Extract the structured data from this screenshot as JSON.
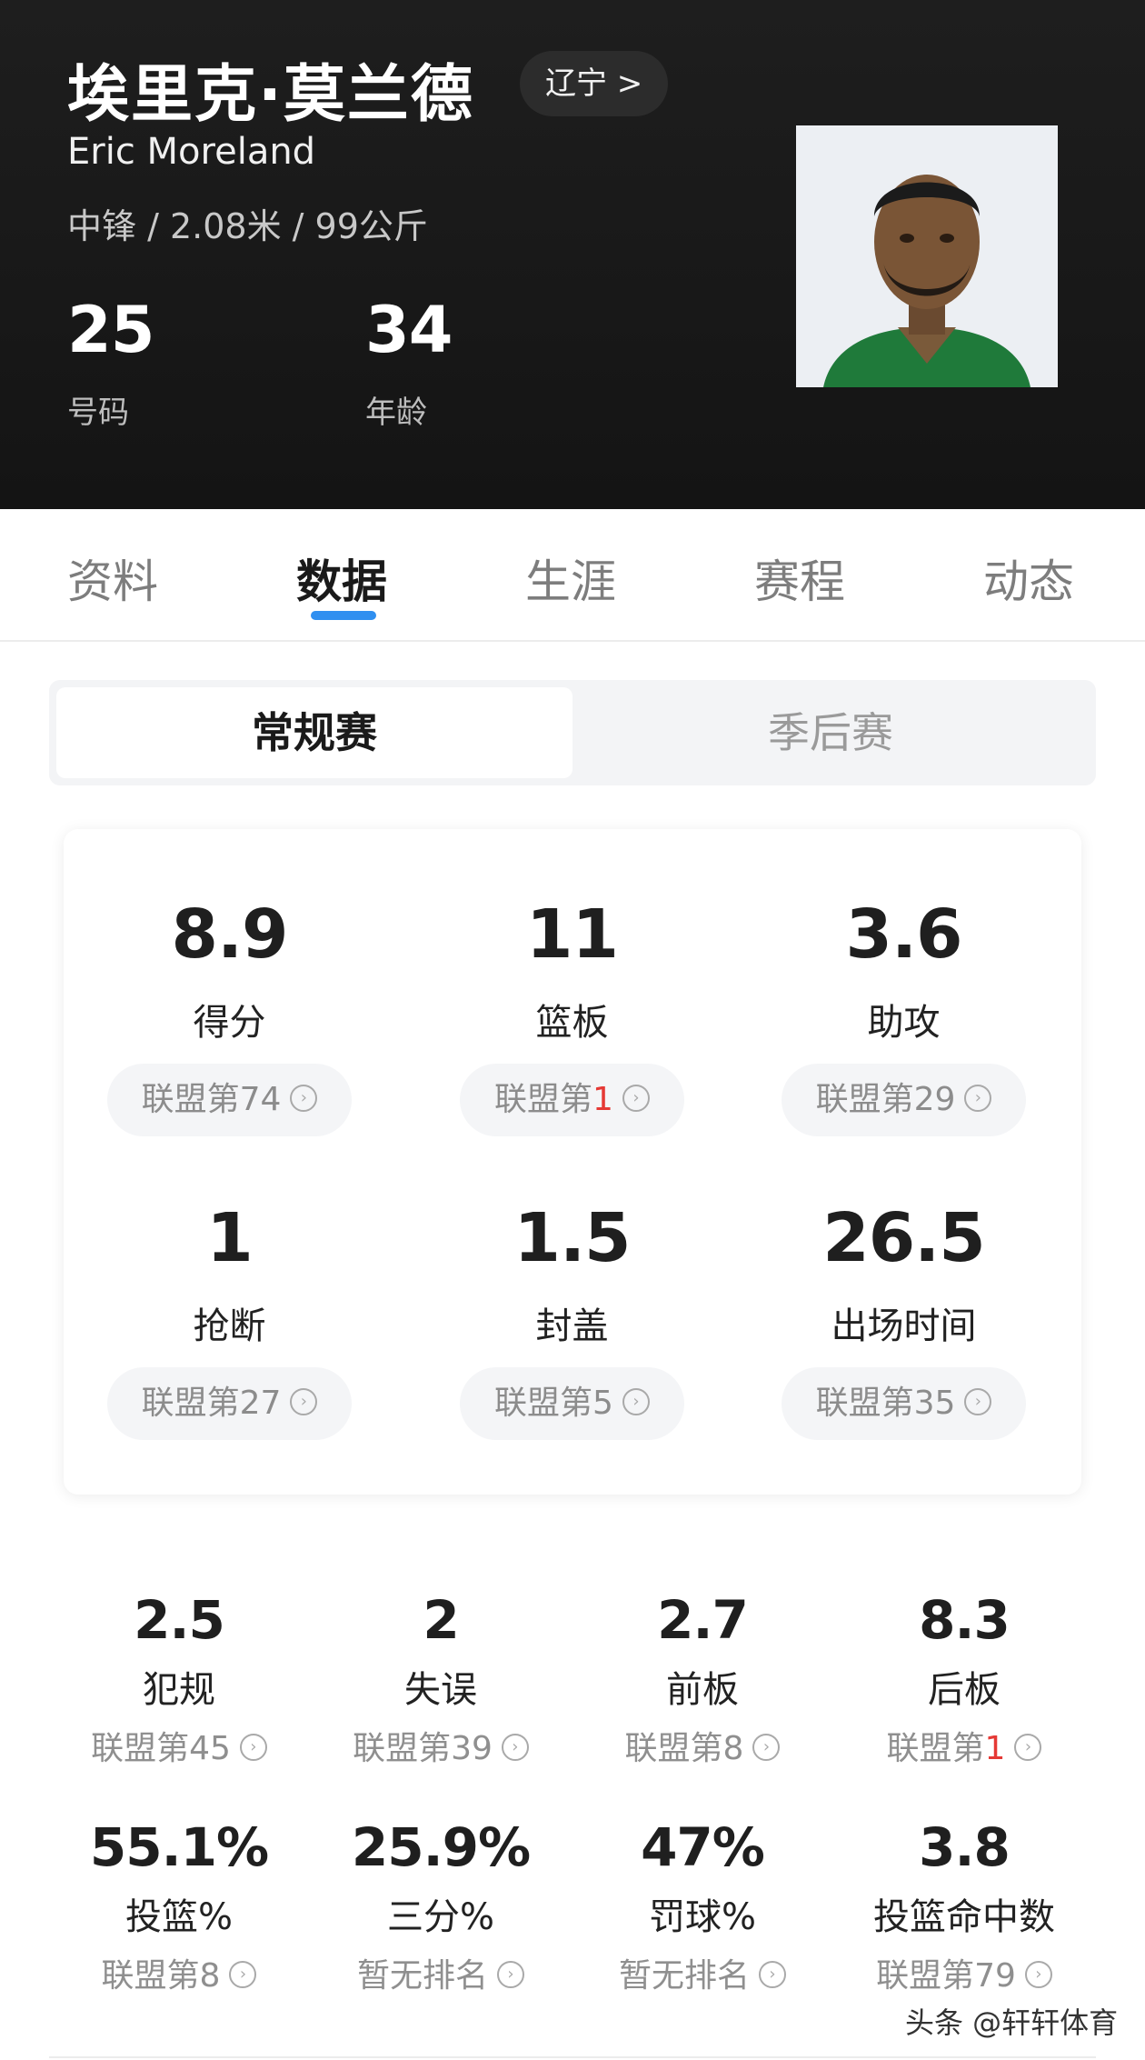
{
  "header": {
    "name_cn": "埃里克·莫兰德",
    "team": "辽宁 >",
    "name_en": "Eric Moreland",
    "meta": "中锋 / 2.08米 / 99公斤",
    "number": "25",
    "number_label": "号码",
    "age": "34",
    "age_label": "年龄",
    "photo_icon": "player-headshot"
  },
  "tabs": [
    {
      "label": "资料",
      "active": false
    },
    {
      "label": "数据",
      "active": true
    },
    {
      "label": "生涯",
      "active": false
    },
    {
      "label": "赛程",
      "active": false
    },
    {
      "label": "动态",
      "active": false
    }
  ],
  "season": {
    "regular": "常规赛",
    "playoffs": "季后赛"
  },
  "main_stats": [
    {
      "value": "8.9",
      "label": "得分",
      "rank_prefix": "联盟第",
      "rank": "74"
    },
    {
      "value": "11",
      "label": "篮板",
      "rank_prefix": "联盟第",
      "rank": "1"
    },
    {
      "value": "3.6",
      "label": "助攻",
      "rank_prefix": "联盟第",
      "rank": "29"
    },
    {
      "value": "1",
      "label": "抢断",
      "rank_prefix": "联盟第",
      "rank": "27"
    },
    {
      "value": "1.5",
      "label": "封盖",
      "rank_prefix": "联盟第",
      "rank": "5"
    },
    {
      "value": "26.5",
      "label": "出场时间",
      "rank_prefix": "联盟第",
      "rank": "35"
    }
  ],
  "sub_stats": [
    {
      "value": "2.5",
      "label": "犯规",
      "rank_prefix": "联盟第",
      "rank": "45"
    },
    {
      "value": "2",
      "label": "失误",
      "rank_prefix": "联盟第",
      "rank": "39"
    },
    {
      "value": "2.7",
      "label": "前板",
      "rank_prefix": "联盟第",
      "rank": "8"
    },
    {
      "value": "8.3",
      "label": "后板",
      "rank_prefix": "联盟第",
      "rank": "1"
    },
    {
      "value": "55.1%",
      "label": "投篮%",
      "rank_prefix": "联盟第",
      "rank": "8"
    },
    {
      "value": "25.9%",
      "label": "三分%",
      "rank_prefix": "暂无排名",
      "rank": ""
    },
    {
      "value": "47%",
      "label": "罚球%",
      "rank_prefix": "暂无排名",
      "rank": ""
    },
    {
      "value": "3.8",
      "label": "投篮命中数",
      "rank_prefix": "联盟第",
      "rank": "79"
    }
  ],
  "watermark": "头条 @轩轩体育",
  "colors": {
    "accent": "#2f8ff0",
    "rank_highlight": "#e53935",
    "header_bg": "#181818"
  }
}
